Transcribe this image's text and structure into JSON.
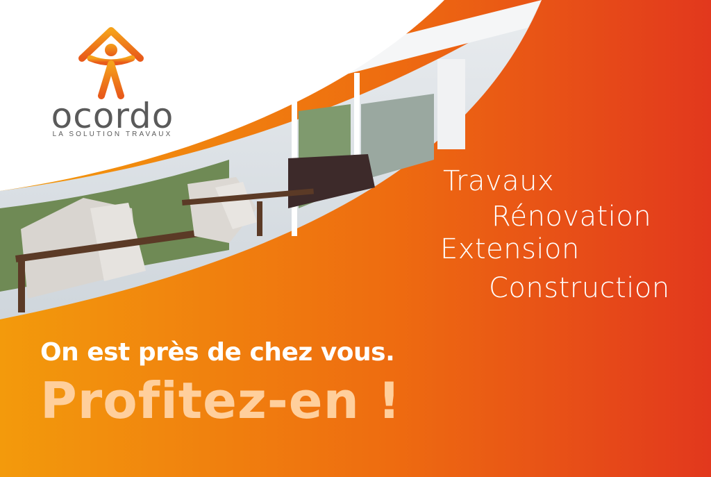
{
  "brand": {
    "name": "ocordo",
    "tagline": "LA SOLUTION TRAVAUX"
  },
  "services": [
    "Travaux",
    "Rénovation",
    "Extension",
    "Construction"
  ],
  "headline": {
    "line1": "On est près de chez vous.",
    "line2": "Profitez-en !"
  },
  "colors": {
    "gradient_start": "#f18a0a",
    "gradient_end": "#e2381d",
    "logo_orange": "#f07d1a",
    "logo_grey": "#5a5a5a",
    "accent_text": "#ffcf9c"
  }
}
